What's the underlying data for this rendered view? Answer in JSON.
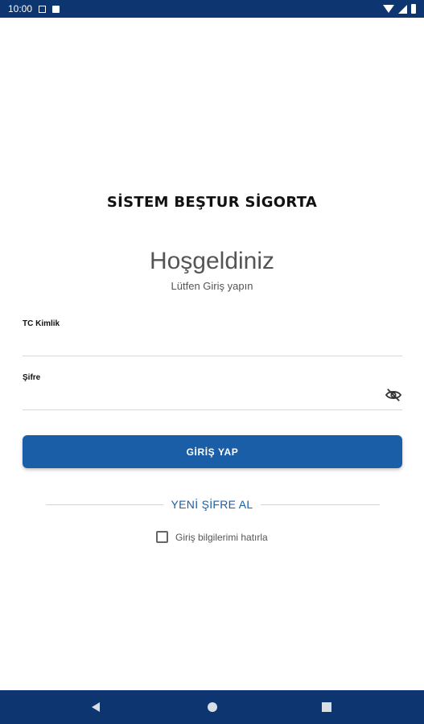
{
  "status_bar": {
    "time": "10:00"
  },
  "brand": {
    "title": "SİSTEM BEŞTUR SİGORTA"
  },
  "welcome": {
    "title": "Hoşgeldiniz",
    "subtitle": "Lütfen Giriş yapın"
  },
  "form": {
    "tc_label": "TC Kimlik",
    "tc_value": "",
    "password_label": "Şifre",
    "password_value": "",
    "login_button": "GİRİŞ YAP",
    "new_password_link": "YENİ ŞİFRE AL",
    "remember_label": "Giriş bilgilerimi hatırla",
    "remember_checked": false
  },
  "colors": {
    "primary": "#1a5ea8",
    "status_bar": "#0d3570",
    "nav_bar": "#0d3570"
  },
  "icons": {
    "password_toggle": "eye-off-icon"
  }
}
